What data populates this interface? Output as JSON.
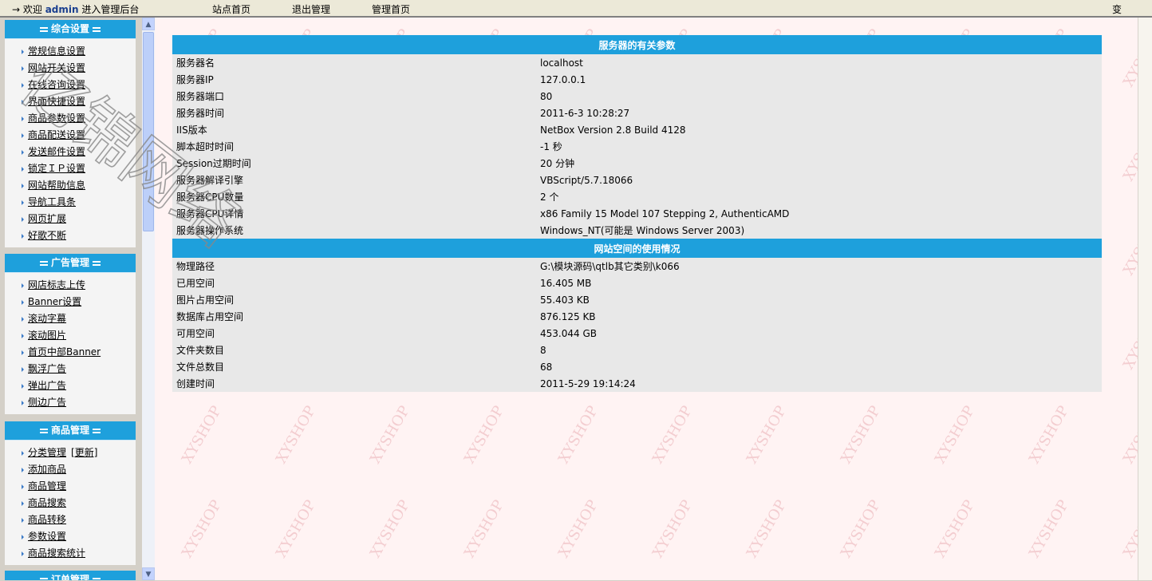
{
  "topbar": {
    "welcome_prefix": "→ 欢迎",
    "user": "admin",
    "welcome_suffix": "进入管理后台",
    "links": [
      "站点首页",
      "退出管理",
      "管理首页"
    ],
    "right_text": "变"
  },
  "menu": [
    {
      "title": "综合设置",
      "items": [
        "常规信息设置",
        "网站开关设置",
        "在线咨询设置",
        "界面快捷设置",
        "商品参数设置",
        "商品配送设置",
        "发送邮件设置",
        "锁定ＩＰ设置",
        "网站帮助信息",
        "导航工具条",
        "网页扩展",
        "好歌不断"
      ]
    },
    {
      "title": "广告管理",
      "items": [
        "网店标志上传",
        "Banner设置",
        "滚动字幕",
        "滚动图片",
        "首页中部Banner",
        "飘浮广告",
        "弹出广告",
        "侧边广告"
      ]
    },
    {
      "title": "商品管理",
      "items": [
        "分类管理",
        "添加商品",
        "商品管理",
        "商品搜索",
        "商品转移",
        "参数设置",
        "商品搜索统计"
      ],
      "extra_link": "[更新]"
    },
    {
      "title": "订单管理",
      "items": []
    }
  ],
  "server_section": {
    "title": "服务器的有关参数",
    "rows": [
      {
        "k": "服务器名",
        "v": "localhost"
      },
      {
        "k": "服务器IP",
        "v": "127.0.0.1"
      },
      {
        "k": "服务器端口",
        "v": "80"
      },
      {
        "k": "服务器时间",
        "v": "2011-6-3 10:28:27"
      },
      {
        "k": "IIS版本",
        "v": "NetBox Version 2.8 Build 4128"
      },
      {
        "k": "脚本超时时间",
        "v": "-1 秒"
      },
      {
        "k": "Session过期时间",
        "v": "20 分钟"
      },
      {
        "k": "服务器解译引擎",
        "v": "VBScript/5.7.18066"
      },
      {
        "k": "服务器CPU数量",
        "v": "2 个"
      },
      {
        "k": "服务器CPU详情",
        "v": "x86 Family 15 Model 107 Stepping 2, AuthenticAMD"
      },
      {
        "k": "服务器操作系统",
        "v": "Windows_NT(可能是 Windows Server 2003)"
      }
    ]
  },
  "space_section": {
    "title": "网站空间的使用情况",
    "rows": [
      {
        "k": "物理路径",
        "v": "G:\\模块源码\\qtlb其它类别\\k066"
      },
      {
        "k": "已用空间",
        "v": "16.405 MB"
      },
      {
        "k": "图片占用空间",
        "v": "55.403 KB"
      },
      {
        "k": "数据库占用空间",
        "v": "876.125 KB"
      },
      {
        "k": "可用空间",
        "v": "453.044 GB"
      },
      {
        "k": "文件夹数目",
        "v": "8"
      },
      {
        "k": "文件总数目",
        "v": "68"
      },
      {
        "k": "创建时间",
        "v": "2011-5-29 19:14:24"
      }
    ]
  },
  "watermark_text": "XYSHOP",
  "handwriting_text": "亿锦网络",
  "colors": {
    "header_blue": "#1ea0dc",
    "row_gray": "#e8e8e8",
    "bg_pink": "#fff3f3"
  }
}
